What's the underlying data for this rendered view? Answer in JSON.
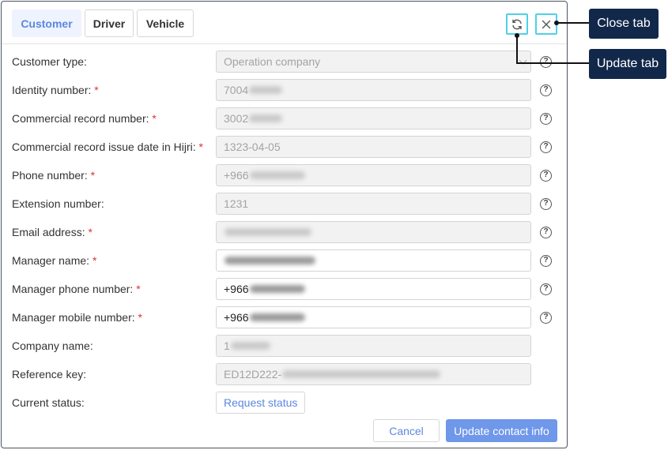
{
  "tabs": [
    {
      "label": "Customer",
      "active": true
    },
    {
      "label": "Driver",
      "active": false
    },
    {
      "label": "Vehicle",
      "active": false
    }
  ],
  "header_icons": {
    "refresh": "refresh-icon",
    "close": "close-icon"
  },
  "callouts": {
    "close_tab": "Close tab",
    "update_tab": "Update tab"
  },
  "fields": [
    {
      "label": "Customer type:",
      "required": false,
      "value": "Operation company",
      "editable": false,
      "dropdown": true
    },
    {
      "label": "Identity number:",
      "required": true,
      "value": "7004",
      "editable": false
    },
    {
      "label": "Commercial record number:",
      "required": true,
      "value": "3002",
      "editable": false
    },
    {
      "label": "Commercial record issue date in Hijri:",
      "required": true,
      "value": "1323-04-05",
      "editable": false
    },
    {
      "label": "Phone number:",
      "required": true,
      "value": "+966",
      "editable": false
    },
    {
      "label": "Extension number:",
      "required": false,
      "value": "1231",
      "editable": false
    },
    {
      "label": "Email address:",
      "required": true,
      "value": "",
      "editable": false
    },
    {
      "label": "Manager name:",
      "required": true,
      "value": "",
      "editable": true
    },
    {
      "label": "Manager phone number:",
      "required": true,
      "value": "+966",
      "editable": true
    },
    {
      "label": "Manager mobile number:",
      "required": true,
      "value": "+966",
      "editable": true
    },
    {
      "label": "Company name:",
      "required": false,
      "value": "1",
      "editable": false
    },
    {
      "label": "Reference key:",
      "required": false,
      "value": "ED12D222-",
      "editable": false
    }
  ],
  "required_mark": "*",
  "help_symbol": "?",
  "current_status": {
    "label": "Current status:",
    "button": "Request status"
  },
  "footer": {
    "cancel": "Cancel",
    "update": "Update contact info"
  },
  "colors": {
    "accent": "#5c87e0",
    "primary_button": "#6f97ea",
    "highlight": "#4fd1e6",
    "callout_bg": "#12284a",
    "required": "#e03131"
  }
}
